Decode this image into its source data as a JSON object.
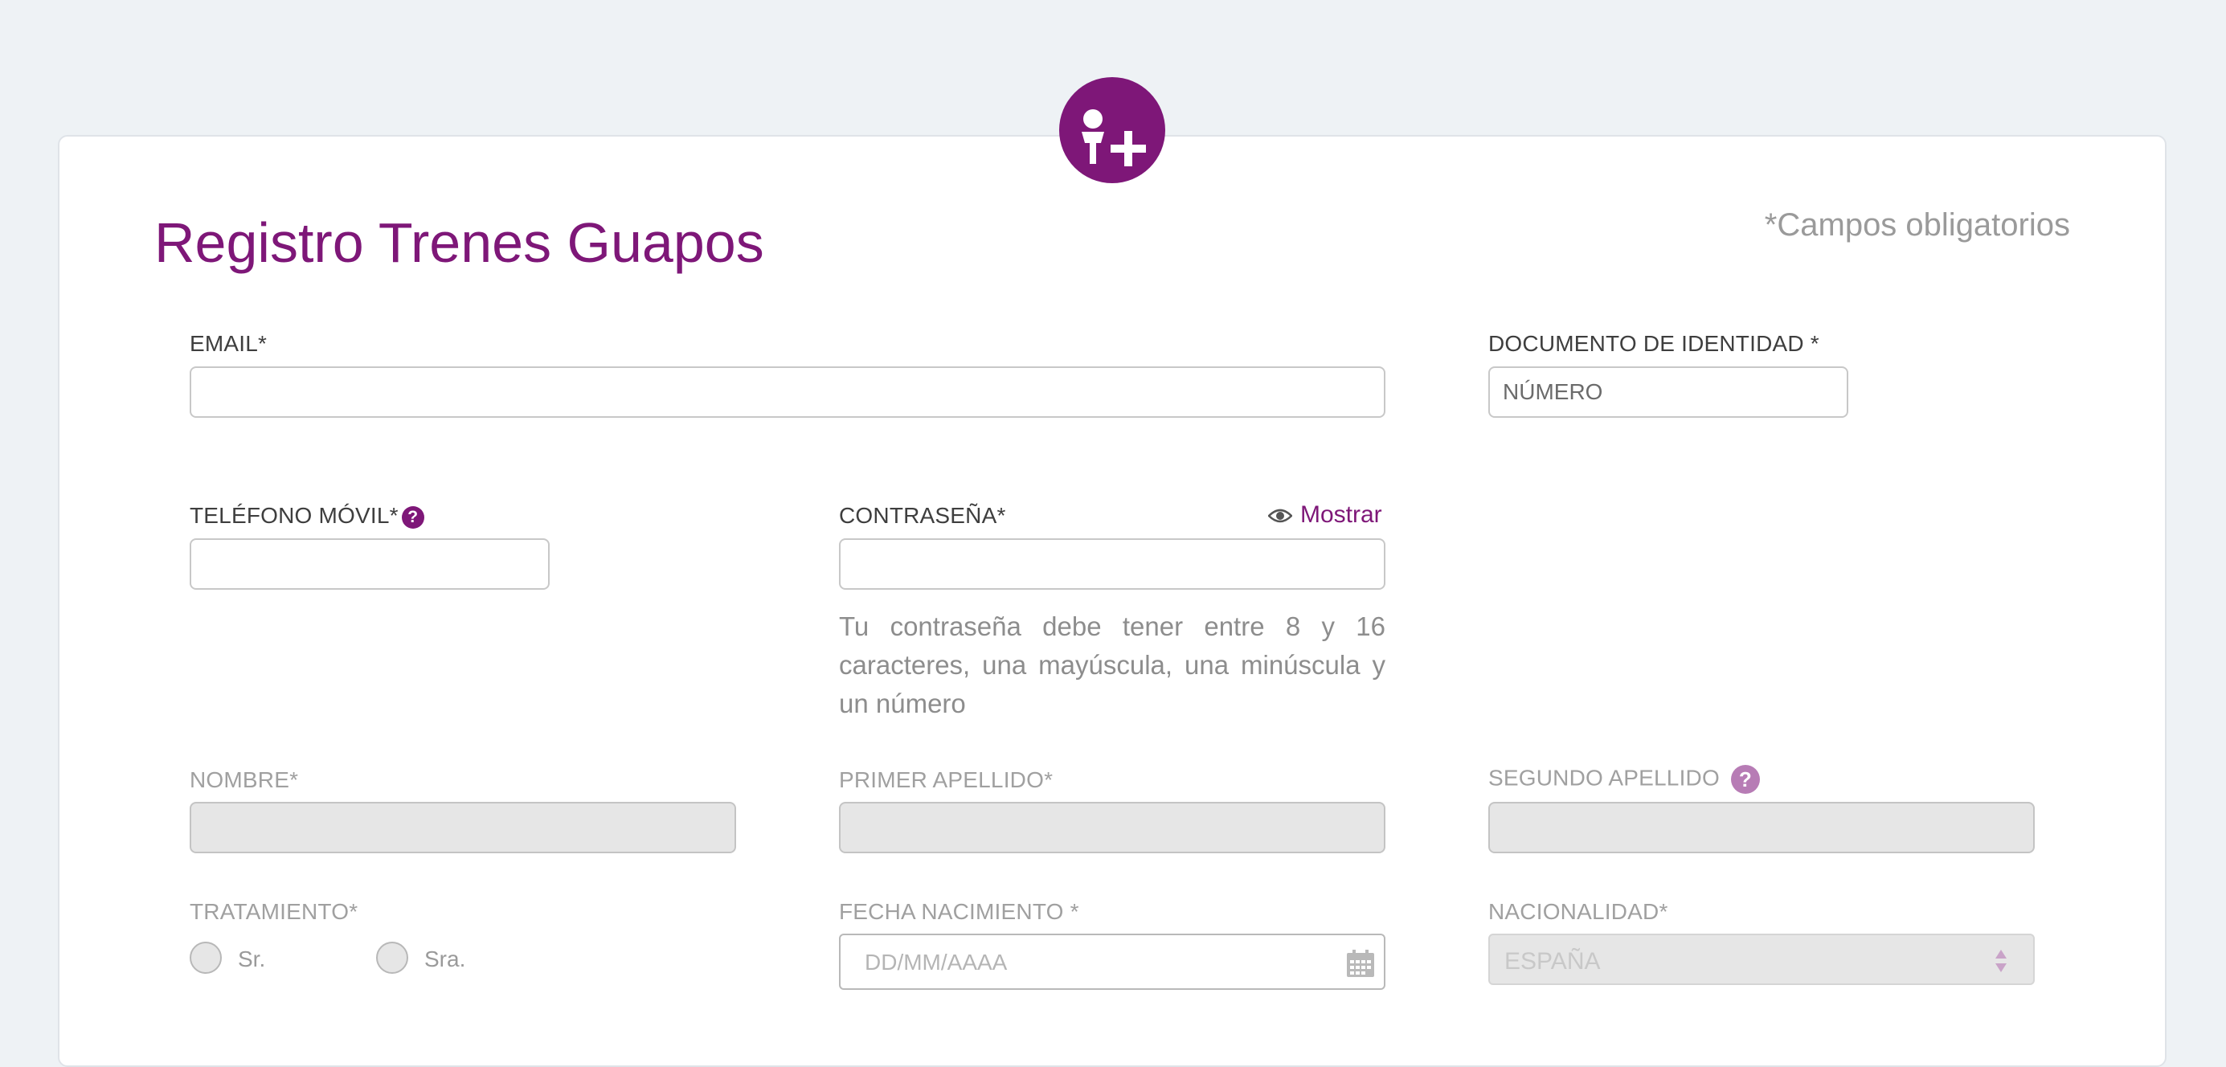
{
  "form": {
    "title": "Registro Trenes Guapos",
    "required_note": "*Campos obligatorios",
    "accent_color": "#7e1778"
  },
  "fields": {
    "email": {
      "label": "EMAIL*",
      "value": ""
    },
    "documento": {
      "label": "DOCUMENTO DE IDENTIDAD *",
      "placeholder": "NÚMERO"
    },
    "telefono": {
      "label": "TELÉFONO MÓVIL*",
      "value": ""
    },
    "contrasena": {
      "label": "CONTRASEÑA*",
      "show_label": "Mostrar",
      "value": ""
    },
    "password_hint": "Tu contraseña debe tener entre 8 y 16 caracteres, una mayúscula, una minúscula y un número",
    "nombre": {
      "label": "NOMBRE*"
    },
    "primer_apellido": {
      "label": "PRIMER APELLIDO*"
    },
    "segundo_apellido": {
      "label": "SEGUNDO APELLIDO"
    },
    "tratamiento": {
      "label": "TRATAMIENTO*",
      "options": [
        "Sr.",
        "Sra."
      ]
    },
    "fecha_nacimiento": {
      "label": "FECHA NACIMIENTO *",
      "placeholder": "DD/MM/AAAA"
    },
    "nacionalidad": {
      "label": "NACIONALIDAD*",
      "selected": "ESPAÑA"
    }
  },
  "icons": {
    "avatar": "add-user-icon",
    "help": "question-icon",
    "show": "eye-icon",
    "calendar": "calendar-icon",
    "select": "sort-arrows-icon"
  }
}
